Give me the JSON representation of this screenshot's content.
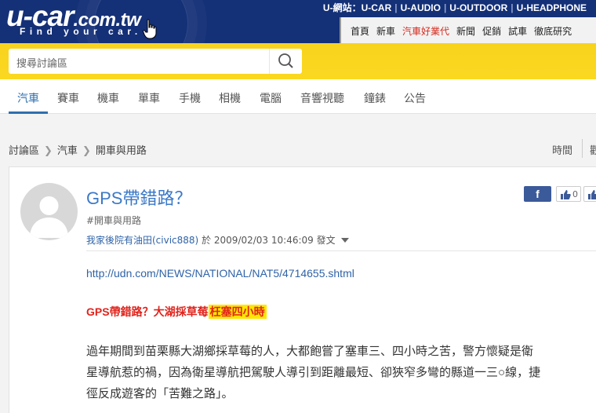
{
  "header": {
    "logo_main": "u-car",
    "logo_domain": ".com.tw",
    "logo_tagline": "Find your car.",
    "site_links": [
      "U-網站：U-CAR",
      "U-AUDIO",
      "U-OUTDOOR",
      "U-HEADPHONE"
    ],
    "nav_links": [
      "首頁",
      "新車",
      "汽車好業代",
      "新聞",
      "促銷",
      "試車",
      "徹底研究"
    ]
  },
  "search": {
    "placeholder": "搜尋討論區"
  },
  "tabs": [
    "汽車",
    "賽車",
    "機車",
    "單車",
    "手機",
    "相機",
    "電腦",
    "音響視聽",
    "鐘錶",
    "公告"
  ],
  "breadcrumb": [
    "討論區",
    "汽車",
    "開車與用路"
  ],
  "sort": {
    "label": "時間",
    "label2": "觀"
  },
  "post": {
    "title": "GPS帶錯路？",
    "tag": "#開車與用路",
    "author": "我家後院有油田(civic888)",
    "posted_prefix": "於",
    "timestamp": "2009/02/03 10:46:09",
    "posted_suffix": "發文",
    "share_label": "f",
    "like_count": "0",
    "url": "http://udn.com/NEWS/NATIONAL/NAT5/4714655.shtml",
    "headline": "GPS帶錯路？大湖採草莓",
    "headline_highlight": "枉塞四小時",
    "body_lines": [
      "過年期間到苗栗縣大湖鄉採草莓的人，大都飽嘗了塞車三、四小時之苦，警方懷疑是衛",
      "星導航惹的禍，因為衛星導航把駕駛人導引到距離最短、卻狹窄多彎的縣道一三○線，捷",
      "徑反成遊客的「苦難之路」。"
    ]
  },
  "colors": {
    "header_bg": "#143077",
    "search_band": "#f8d31e",
    "link": "#2f63a7",
    "title": "#3b79c7",
    "headline_red": "#e0231c",
    "highlight": "#ffe600"
  }
}
